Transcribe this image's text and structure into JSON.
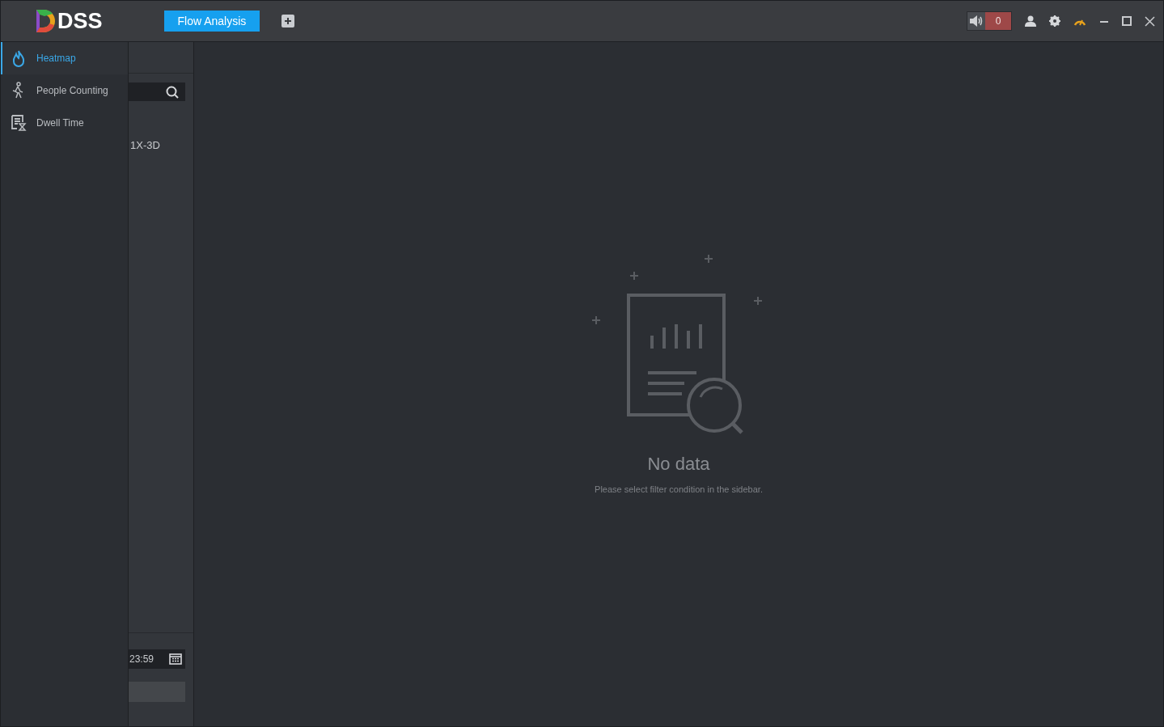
{
  "app": {
    "logo": "DSS"
  },
  "tabs": [
    {
      "label": "Flow Analysis",
      "selected": true
    }
  ],
  "toolbar": {
    "alarm_count": "0"
  },
  "menu": {
    "items": [
      {
        "label": "Heatmap",
        "selected": true
      },
      {
        "label": "People Counting",
        "selected": false
      },
      {
        "label": "Dwell Time",
        "selected": false
      }
    ]
  },
  "sidebar": {
    "tree_items": [
      {
        "label": "1X-3D"
      }
    ],
    "date_range": "23:59"
  },
  "empty_state": {
    "title": "No data",
    "message": "Please select filter condition in the sidebar."
  }
}
